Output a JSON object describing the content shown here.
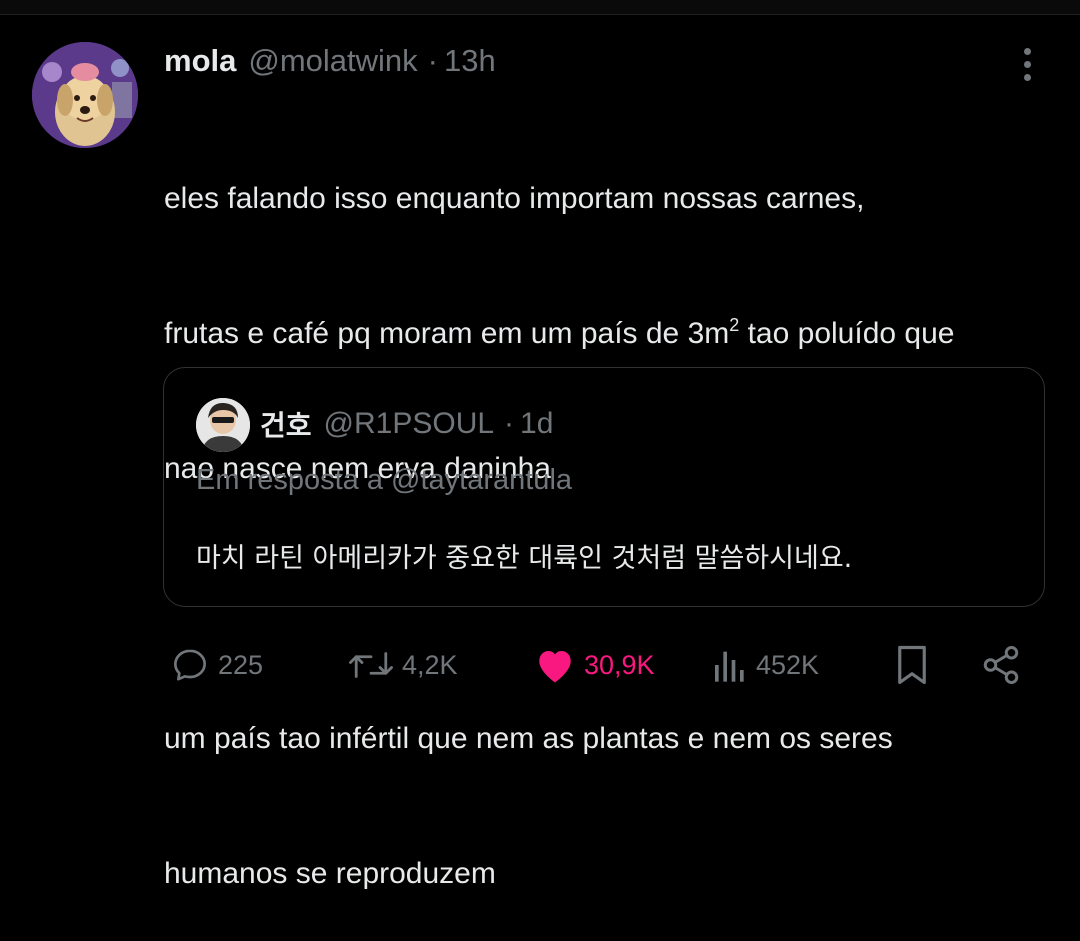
{
  "tweet": {
    "display_name": "mola",
    "handle": "@molatwink",
    "separator": "·",
    "time": "13h",
    "text_lines": [
      "eles falando isso enquanto importam nossas carnes,",
      "frutas e café pq moram em um país de 3m",
      "nao nasce nem erva daninha",
      "",
      "um país tao infértil que nem as plantas e nem os seres",
      "humanos se reproduzem"
    ],
    "superscript": "2",
    "line2_tail": " tao poluído que"
  },
  "quote": {
    "display_name": "건호",
    "handle": "@R1PSOUL",
    "separator": "·",
    "time": "1d",
    "reply_to": "Em resposta a @taytarantula",
    "text": "마치 라틴 아메리카가 중요한 대륙인 것처럼 말씀하시네요."
  },
  "actions": {
    "reply_count": "225",
    "retweet_count": "4,2K",
    "like_count": "30,9K",
    "views_count": "452K",
    "liked": true
  },
  "icons": {
    "reply": "reply-icon",
    "retweet": "retweet-icon",
    "like": "heart-icon",
    "views": "views-icon",
    "bookmark": "bookmark-icon",
    "share": "share-icon",
    "more": "more-icon"
  },
  "colors": {
    "background": "#000000",
    "text": "#e7e9ea",
    "muted": "#71767b",
    "like": "#f91880",
    "border": "#2f3336"
  }
}
